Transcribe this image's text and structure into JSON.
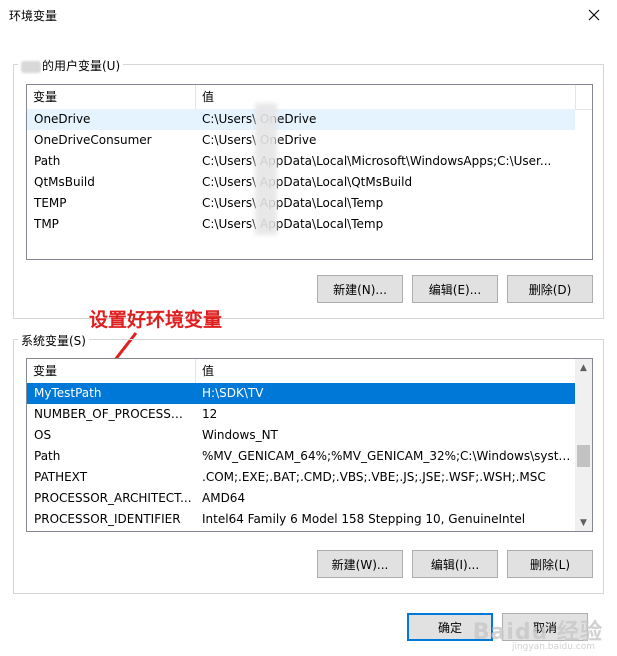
{
  "window": {
    "title": "环境变量"
  },
  "user_group": {
    "label_suffix": "的用户变量(U)"
  },
  "user_list": {
    "headers": [
      "变量",
      "值"
    ],
    "rows": [
      {
        "name": "OneDrive",
        "value": "C:\\Users\\     OneDrive"
      },
      {
        "name": "OneDriveConsumer",
        "value": "C:\\Users\\     OneDrive"
      },
      {
        "name": "Path",
        "value": "C:\\Users\\     AppData\\Local\\Microsoft\\WindowsApps;C:\\User..."
      },
      {
        "name": "QtMsBuild",
        "value": "C:\\Users\\     AppData\\Local\\QtMsBuild"
      },
      {
        "name": "TEMP",
        "value": "C:\\Users\\     AppData\\Local\\Temp"
      },
      {
        "name": "TMP",
        "value": "C:\\Users\\     AppData\\Local\\Temp"
      }
    ]
  },
  "user_buttons": {
    "new": "新建(N)...",
    "edit": "编辑(E)...",
    "delete": "删除(D)"
  },
  "annotation": "设置好环境变量",
  "system_group": {
    "label": "系统变量(S)"
  },
  "system_list": {
    "headers": [
      "变量",
      "值"
    ],
    "rows": [
      {
        "name": "MyTestPath",
        "value": "H:\\SDK\\TV"
      },
      {
        "name": "NUMBER_OF_PROCESSORS",
        "value": "12"
      },
      {
        "name": "OS",
        "value": "Windows_NT"
      },
      {
        "name": "Path",
        "value": "%MV_GENICAM_64%;%MV_GENICAM_32%;C:\\Windows\\syste..."
      },
      {
        "name": "PATHEXT",
        "value": ".COM;.EXE;.BAT;.CMD;.VBS;.VBE;.JS;.JSE;.WSF;.WSH;.MSC"
      },
      {
        "name": "PROCESSOR_ARCHITECT...",
        "value": "AMD64"
      },
      {
        "name": "PROCESSOR_IDENTIFIER",
        "value": "Intel64 Family 6 Model 158 Stepping 10, GenuineIntel"
      }
    ],
    "selected_index": 0
  },
  "system_buttons": {
    "new": "新建(W)...",
    "edit": "编辑(I)...",
    "delete": "删除(L)"
  },
  "dialog_buttons": {
    "ok": "确定",
    "cancel": "取消"
  },
  "watermark": {
    "text": "Baidu 经验",
    "sub": "jingyan.baidu.com"
  },
  "colors": {
    "selection": "#0078d7",
    "annotation": "#e02020"
  }
}
